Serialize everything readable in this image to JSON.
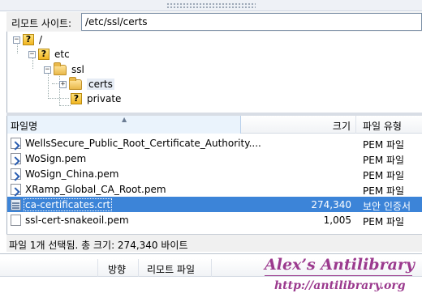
{
  "remote_site": {
    "label": "리모트 사이트:",
    "path": "/etc/ssl/certs"
  },
  "tree": {
    "root": "/",
    "etc": "etc",
    "ssl": "ssl",
    "certs": "certs",
    "private": "private"
  },
  "file_list": {
    "columns": {
      "name": "파일명",
      "size": "크기",
      "type": "파일 유형"
    },
    "rows": [
      {
        "name": "WellsSecure_Public_Root_Certificate_Authority....",
        "size": "",
        "type": "PEM 파일",
        "icon": "link-file-icon"
      },
      {
        "name": "WoSign.pem",
        "size": "",
        "type": "PEM 파일",
        "icon": "link-file-icon"
      },
      {
        "name": "WoSign_China.pem",
        "size": "",
        "type": "PEM 파일",
        "icon": "link-file-icon"
      },
      {
        "name": "XRamp_Global_CA_Root.pem",
        "size": "",
        "type": "PEM 파일",
        "icon": "link-file-icon"
      },
      {
        "name": "ca-certificates.crt",
        "size": "274,340",
        "type": "보안 인증서",
        "icon": "certificate-icon",
        "selected": true
      },
      {
        "name": "ssl-cert-snakeoil.pem",
        "size": "1,005",
        "type": "PEM 파일",
        "icon": "file-icon"
      }
    ]
  },
  "status": {
    "text": "파일 1개 선택됨. 총 크기: 274,340 바이트"
  },
  "queue": {
    "direction": "방향",
    "remote_file": "리모트 파일"
  },
  "watermark": {
    "title": "Alex’s Antilibrary",
    "url": "http://antilibrary.org"
  },
  "colors": {
    "selection": "#3c84d8",
    "watermark": "#9b3a8e"
  }
}
